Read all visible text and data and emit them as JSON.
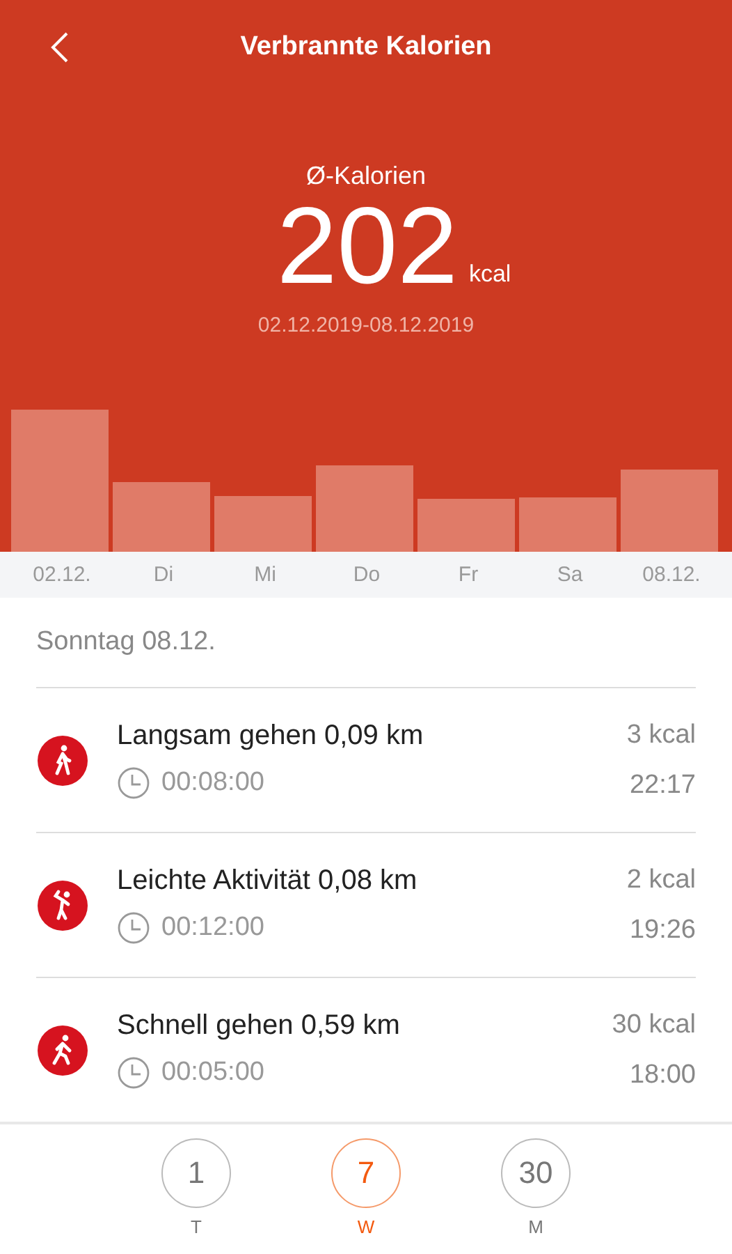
{
  "header": {
    "title": "Verbrannte Kalorien",
    "label": "Ø-Kalorien",
    "value": "202",
    "unit": "kcal",
    "range": "02.12.2019-08.12.2019"
  },
  "chart_labels": [
    "02.12.",
    "Di",
    "Mi",
    "Do",
    "Fr",
    "Sa",
    "08.12."
  ],
  "day_title": "Sonntag 08.12.",
  "activities": [
    {
      "kind": "walk",
      "name": "Langsam gehen 0,09 km",
      "duration": "00:08:00",
      "kcal": "3 kcal",
      "time": "22:17"
    },
    {
      "kind": "light",
      "name": "Leichte Aktivität 0,08 km",
      "duration": "00:12:00",
      "kcal": "2 kcal",
      "time": "19:26"
    },
    {
      "kind": "fast",
      "name": "Schnell gehen 0,59 km",
      "duration": "00:05:00",
      "kcal": "30 kcal",
      "time": "18:00"
    }
  ],
  "periods": [
    {
      "number": "1",
      "label": "T",
      "selected": false
    },
    {
      "number": "7",
      "label": "W",
      "selected": true
    },
    {
      "number": "30",
      "label": "M",
      "selected": false
    }
  ]
}
